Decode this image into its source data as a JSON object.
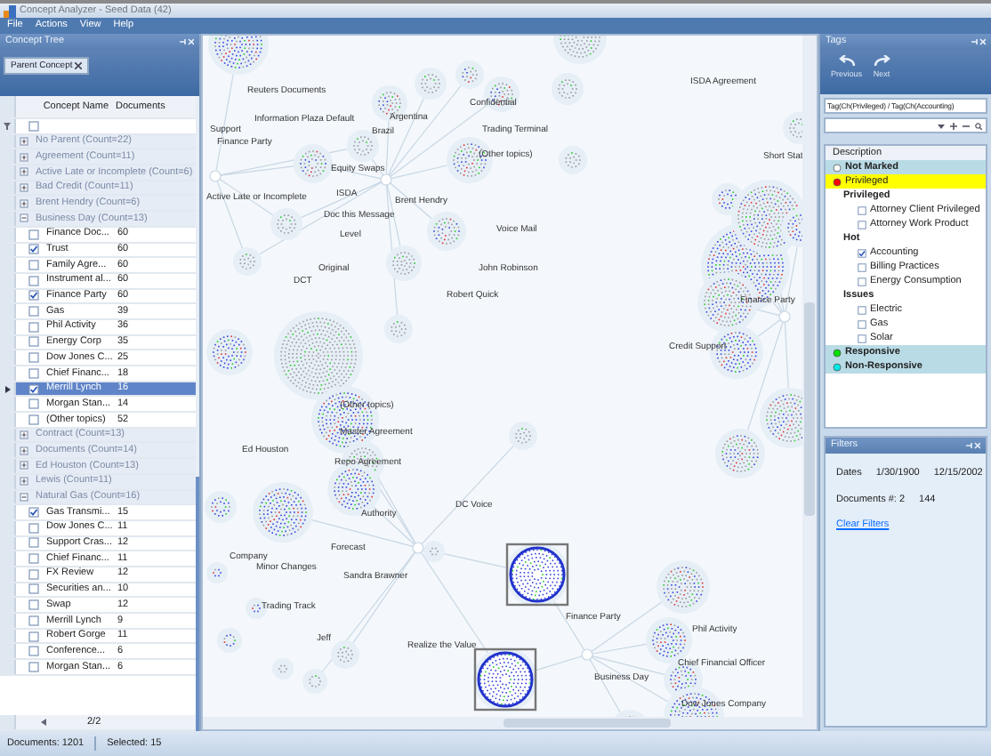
{
  "window": {
    "title": "Concept Analyzer - Seed Data (42)"
  },
  "menu": [
    "File",
    "Actions",
    "View",
    "Help"
  ],
  "concept_tree": {
    "title": "Concept Tree",
    "parent_chip": "Parent Concept",
    "columns": [
      "Concept Name",
      "Documents"
    ],
    "footer_pager": "2/2",
    "filter_checked": false,
    "groups": [
      {
        "label": "No Parent (Count=22)",
        "expanded": false
      },
      {
        "label": "Agreement (Count=11)",
        "expanded": false
      },
      {
        "label": "Active Late or Incomplete (Count=6)",
        "expanded": false
      },
      {
        "label": "Bad Credit (Count=11)",
        "expanded": false
      },
      {
        "label": "Brent Hendry (Count=6)",
        "expanded": false
      },
      {
        "label": "Business Day (Count=13)",
        "expanded": true,
        "children": [
          {
            "name": "Finance Doc...",
            "documents": "60",
            "checked": false,
            "selected": false
          },
          {
            "name": "Trust",
            "documents": "60",
            "checked": true,
            "selected": false
          },
          {
            "name": "Family Agre...",
            "documents": "60",
            "checked": false,
            "selected": false
          },
          {
            "name": "Instrument al...",
            "documents": "60",
            "checked": false,
            "selected": false
          },
          {
            "name": "Finance Party",
            "documents": "60",
            "checked": true,
            "selected": false
          },
          {
            "name": "Gas",
            "documents": "39",
            "checked": false,
            "selected": false
          },
          {
            "name": "Phil Activity",
            "documents": "36",
            "checked": false,
            "selected": false
          },
          {
            "name": "Energy Corp",
            "documents": "35",
            "checked": false,
            "selected": false
          },
          {
            "name": "Dow Jones C...",
            "documents": "25",
            "checked": false,
            "selected": false
          },
          {
            "name": "Chief Financ...",
            "documents": "18",
            "checked": false,
            "selected": false
          },
          {
            "name": "Merrill Lynch",
            "documents": "16",
            "checked": true,
            "selected": true
          },
          {
            "name": "Morgan Stan...",
            "documents": "14",
            "checked": false,
            "selected": false
          },
          {
            "name": "(Other topics)",
            "documents": "52",
            "checked": false,
            "selected": false
          }
        ]
      },
      {
        "label": "Contract (Count=13)",
        "expanded": false
      },
      {
        "label": "Documents (Count=14)",
        "expanded": false
      },
      {
        "label": "Ed Houston (Count=13)",
        "expanded": false
      },
      {
        "label": "Lewis (Count=11)",
        "expanded": false
      },
      {
        "label": "Natural Gas (Count=16)",
        "expanded": true,
        "children": [
          {
            "name": "Gas Transmi...",
            "documents": "15",
            "checked": true,
            "selected": false
          },
          {
            "name": "Dow Jones C...",
            "documents": "11",
            "checked": false,
            "selected": false
          },
          {
            "name": "Support Cras...",
            "documents": "12",
            "checked": false,
            "selected": false
          },
          {
            "name": "Chief Financ...",
            "documents": "11",
            "checked": false,
            "selected": false
          },
          {
            "name": "FX Review",
            "documents": "12",
            "checked": false,
            "selected": false
          },
          {
            "name": "Securities an...",
            "documents": "10",
            "checked": false,
            "selected": false
          },
          {
            "name": "Swap",
            "documents": "12",
            "checked": false,
            "selected": false
          },
          {
            "name": "Merrill Lynch",
            "documents": "9",
            "checked": false,
            "selected": false
          },
          {
            "name": "Robert Gorge",
            "documents": "11",
            "checked": false,
            "selected": false
          },
          {
            "name": "Conference...",
            "documents": "6",
            "checked": false,
            "selected": false
          },
          {
            "name": "Morgan Stan...",
            "documents": "6",
            "checked": false,
            "selected": false
          }
        ]
      }
    ]
  },
  "graph": {
    "labels": [
      "Reuters Documents",
      "Information Plaza Default",
      "Confidential",
      "Argentina",
      "Support",
      "Brazil",
      "Finance Party",
      "Trading Terminal",
      "ISDA Agreement",
      "(Other topics)",
      "Equity Swaps",
      "Short Stat",
      "Active Late or Incomplete",
      "ISDA",
      "Brent Hendry",
      "Doc this Message",
      "Voice Mail",
      "Level",
      "Original",
      "John Robinson",
      "DCT",
      "Robert Quick",
      "Finance Party",
      "Credit Support",
      "(Other topics)",
      "Master Agreement",
      "Ed Houston",
      "Repo Agreement",
      "DC Voice",
      "Authority",
      "Forecast",
      "Company",
      "Minor Changes",
      "Sandra Brawner",
      "Trading Track",
      "Finance Party",
      "Phil Activity",
      "Jeff",
      "Realize the Value",
      "Chief Financial Officer",
      "Business Day",
      "Dow Jones Company"
    ]
  },
  "tags": {
    "title": "Tags",
    "buttons": [
      "Previous",
      "Next"
    ],
    "query": "Tag(Ch(Privileged) / Tag(Ch(Accounting)",
    "column": "Description",
    "items": [
      {
        "label": "Not Marked",
        "color": "#ffffff",
        "selected": false
      },
      {
        "label": "Privileged",
        "color": "#ff0000",
        "selected": true,
        "children": [
          {
            "label": "Privileged",
            "children": [
              {
                "label": "Attorney Client Privileged",
                "checked": false
              },
              {
                "label": "Attorney Work Product",
                "checked": false
              }
            ]
          },
          {
            "label": "Hot",
            "children": [
              {
                "label": "Accounting",
                "checked": true
              },
              {
                "label": "Billing Practices",
                "checked": false
              },
              {
                "label": "Energy Consumption",
                "checked": false
              }
            ]
          },
          {
            "label": "Issues",
            "children": [
              {
                "label": "Electric",
                "checked": false
              },
              {
                "label": "Gas",
                "checked": false
              },
              {
                "label": "Solar",
                "checked": false
              }
            ]
          }
        ]
      },
      {
        "label": "Responsive",
        "color": "#00e000",
        "selected": false
      },
      {
        "label": "Non-Responsive",
        "color": "#00e8e8",
        "selected": false
      }
    ]
  },
  "filters": {
    "title": "Filters",
    "dates_label": "Dates",
    "date_from": "1/30/1900",
    "date_to": "12/15/2002",
    "documents_label": "Documents #: 2",
    "documents_value": "144",
    "clear": "Clear Filters"
  },
  "status_bar": [
    "Documents: 1201",
    "Selected: 15"
  ]
}
